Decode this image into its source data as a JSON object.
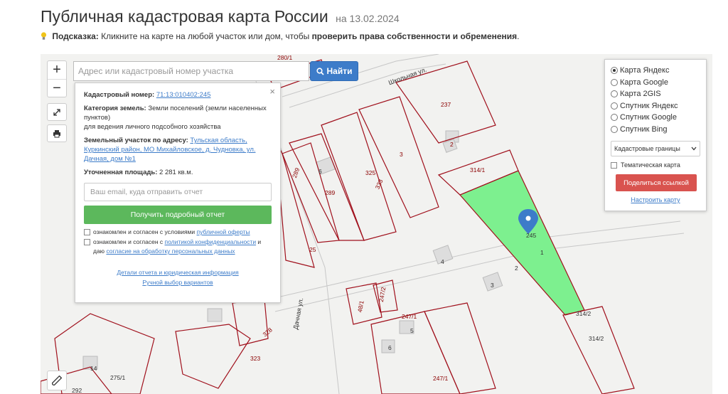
{
  "header": {
    "title": "Публичная кадастровая карта России",
    "date": "на 13.02.2024"
  },
  "hint": {
    "label": "Подсказка:",
    "text": " Кликните на карте на любой участок или дом, чтобы ",
    "emphasis": "проверить права собственности и обременения",
    "end": "."
  },
  "map_controls": {
    "zoom_in": "+",
    "zoom_out": "−",
    "search_placeholder": "Адрес или кадастровый номер участка",
    "find_label": "Найти"
  },
  "info_card": {
    "cadastral_label": "Кадастровый номер:",
    "cadastral_value": "71:13:010402:245",
    "category_label": "Категория земель:",
    "category_value": "Земли поселений (земли населенных пунктов)",
    "usage_value": "для ведения личного подсобного хозяйства",
    "address_label": "Земельный участок по адресу:",
    "address_value": "Тульская область, Куркинский район, МО Михайловское, д. Чудновка, ул. Дачная, дом №1",
    "area_label": "Уточненная площадь:",
    "area_value": "2 281 кв.м.",
    "email_placeholder": "Ваш email, куда отправить отчет",
    "report_button": "Получить подробный отчет",
    "agree1_text": "ознакомлен и согласен с условиями ",
    "agree1_link": "публичной оферты",
    "agree2_text": "ознакомлен и согласен с ",
    "agree2_link": "политикой конфиденциальности",
    "agree2_text2": " и даю ",
    "agree2_link2": "согласие на обработку персональных данных",
    "details_link": "Детали отчета и юридическая информация",
    "manual_link": "Ручной выбор вариантов",
    "close": "×"
  },
  "layers": {
    "options": [
      "Карта Яндекс",
      "Карта Google",
      "Карта 2GIS",
      "Спутник Яндекс",
      "Спутник Google",
      "Спутник Bing"
    ],
    "selected_index": 0,
    "select_value": "Кадастровые границы",
    "thematic_label": "Тематическая карта",
    "share_button": "Поделиться ссылкой",
    "setup_link": "Настроить карту"
  },
  "map_labels": {
    "street1": "Школьная ул.",
    "street2": "Дачная ул.",
    "p280_1": "280/1",
    "p237": "237",
    "p2a": "2",
    "p3": "3",
    "p314_1": "314/1",
    "p289a": "289",
    "p6a": "6",
    "p325": "325",
    "p333": "333",
    "p289b": "289",
    "p245": "245",
    "p1": "1",
    "p25": "25",
    "p4": "4",
    "p2b": "2",
    "p3b": "3",
    "p48_1": "48/1",
    "p247_2": "247/2",
    "p247_1a": "247/1",
    "p5": "5",
    "p314_2a": "314/2",
    "p314_2b": "314/2",
    "p328": "328",
    "p323": "323",
    "p6b": "6",
    "p14": "14",
    "p275_1": "275/1",
    "p247_1b": "247/1",
    "p292": "292"
  },
  "colors": {
    "selected_parcel": "#7df08f",
    "parcel_border": "#a0101c",
    "find_button": "#3d7cc9",
    "report_button": "#5cb85c",
    "share_button": "#d9534f",
    "marker": "#3d7cc9"
  }
}
